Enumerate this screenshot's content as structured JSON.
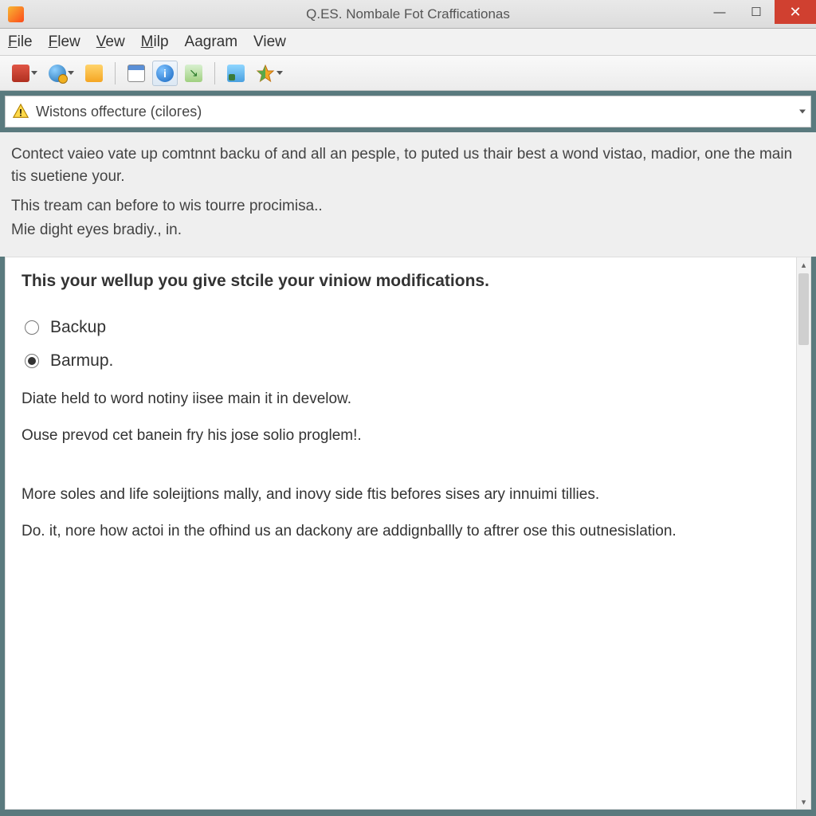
{
  "window": {
    "title": "Q.ES. Nombale Fot Crafficationas"
  },
  "menubar": {
    "items": [
      {
        "label": "File",
        "mnemonic_index": 0
      },
      {
        "label": "Flew",
        "mnemonic_index": 0
      },
      {
        "label": "Vew",
        "mnemonic_index": 0
      },
      {
        "label": "Milp",
        "mnemonic_index": 0
      },
      {
        "label": "Aagram",
        "mnemonic_index": -1
      },
      {
        "label": "View",
        "mnemonic_index": -1
      }
    ]
  },
  "notice": {
    "text": "Wistons offecture (cilогes)"
  },
  "intro": {
    "p1": "Contect vaieo vate up comtnnt backu of and all an pesple, to puted us thair best a wond vistao, madior, one the main tis suetiene your.",
    "p2": "This tream can before to wis tourre procimisa..",
    "p3": "Mie dight eyes bradiy., in."
  },
  "content": {
    "heading": "This your wellup you give stcile your viniow modifications.",
    "options": {
      "opt1": "Backup",
      "opt2": "Barmup.",
      "selected": 1
    },
    "body1": "Diate held to word notiny iisee main it in develow.",
    "body2": "Ouse prevod cet banein fry his jose solio proglem!.",
    "body3": "More soles and life soleijtions mally, and inovy side ftis befores sises ary innuimi tillies.",
    "body4": "Do. it, nore how actoi in the ofhind us an dackony are addignballly to aftrer ose this outnesislation."
  }
}
